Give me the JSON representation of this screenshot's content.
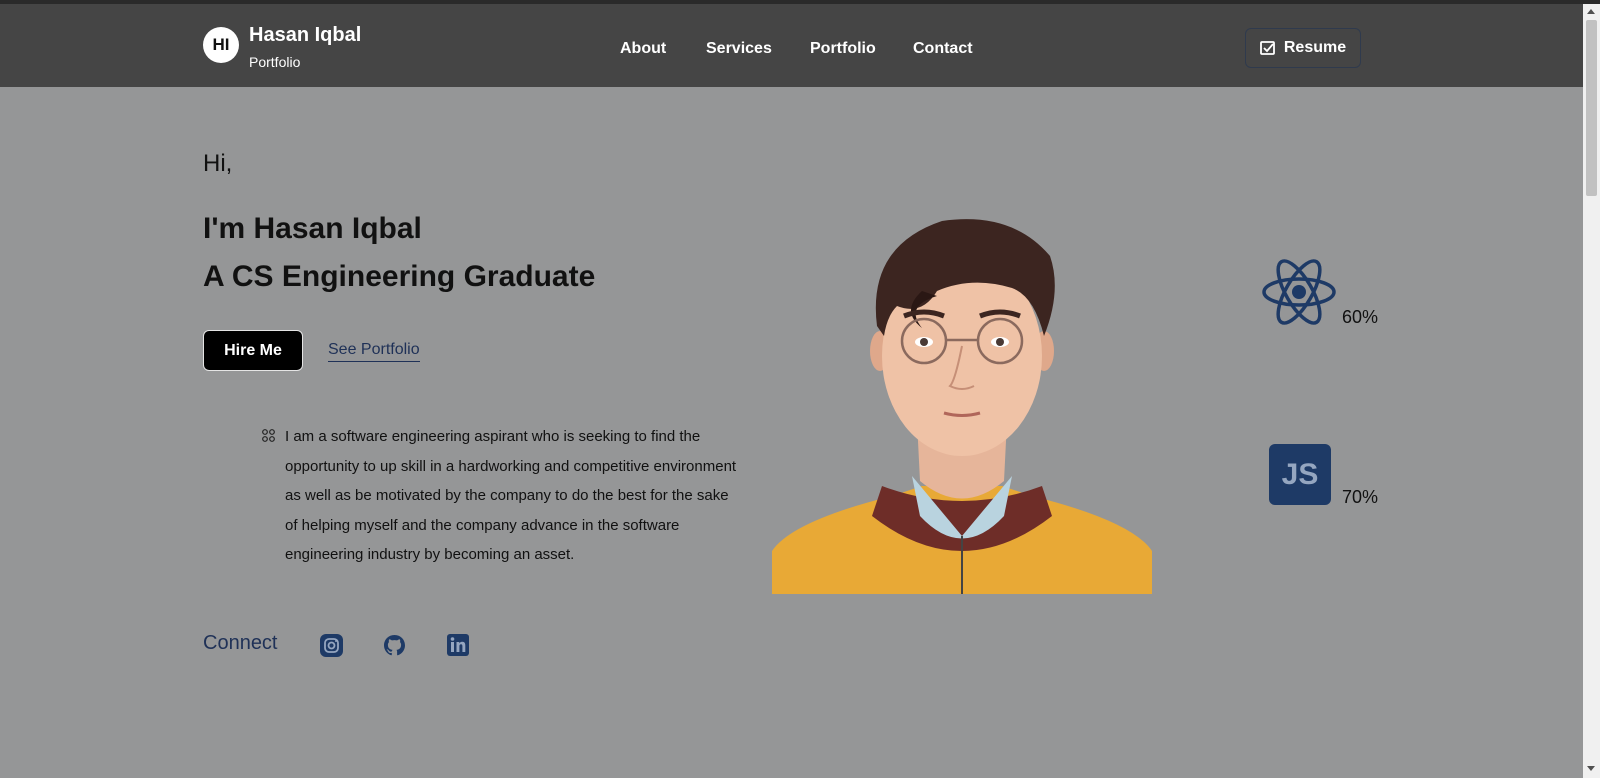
{
  "header": {
    "logo_initials": "HI",
    "brand_name": "Hasan Iqbal",
    "brand_sub": "Portfolio",
    "nav": [
      "About",
      "Services",
      "Portfolio",
      "Contact"
    ],
    "resume_label": "Resume"
  },
  "hero": {
    "greeting": "Hi,",
    "heading_1": "I'm Hasan Iqbal",
    "heading_2": "A CS Engineering Graduate",
    "hire_label": "Hire Me",
    "portfolio_link": "See Portfolio",
    "bio": "I am a software engineering aspirant who is seeking to find the opportunity to up skill in a hardworking and competitive environment as well as be motivated by the company to do the best for the sake of helping myself and the company advance in the software engineering industry by becoming an asset."
  },
  "skills": [
    {
      "icon": "react-icon",
      "percent": "60%"
    },
    {
      "icon": "javascript-icon",
      "label": "JS",
      "percent": "70%"
    }
  ],
  "connect": {
    "label": "Connect",
    "socials": [
      "instagram-icon",
      "github-icon",
      "linkedin-icon"
    ]
  },
  "colors": {
    "header_bg": "#454545",
    "page_bg": "#959697",
    "accent_navy": "#1e3a66"
  }
}
